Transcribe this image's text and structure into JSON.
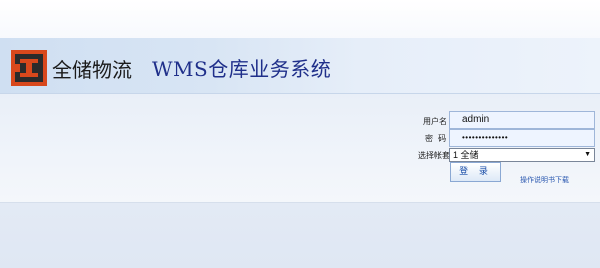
{
  "header": {
    "brand": "全储物流",
    "system_title": "WMS仓库业务系统",
    "logo_icon": "warehouse-logo-icon",
    "logo_color": "#d8481c"
  },
  "login": {
    "username_label": "用户名",
    "username_value": "admin",
    "password_label": "密  码",
    "password_value": "••••••••••••••",
    "account_label": "选择帐套",
    "account_selected": "1 全储",
    "account_arrow": "▼",
    "login_button": "登 录",
    "manual_link": "操作说明书下载"
  },
  "colors": {
    "title_blue": "#1f2f8a",
    "link_blue": "#2a58b0",
    "banner_blue": "#cfdff2"
  }
}
